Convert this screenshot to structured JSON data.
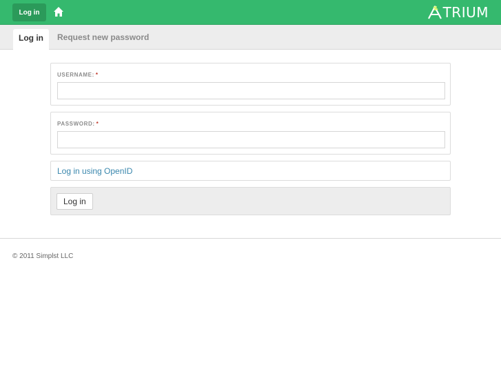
{
  "header": {
    "login_label": "Log in",
    "brand_text": "TRIUM",
    "accent_color": "#35b96e"
  },
  "tabs": [
    {
      "label": "Log in",
      "active": true
    },
    {
      "label": "Request new password",
      "active": false
    }
  ],
  "form": {
    "username": {
      "label": "USERNAME:",
      "required_marker": "*",
      "value": ""
    },
    "password": {
      "label": "PASSWORD:",
      "required_marker": "*",
      "value": ""
    },
    "openid_link": "Log in using OpenID",
    "submit_label": "Log in"
  },
  "footer": {
    "copyright": "© 2011 Simplst LLC"
  }
}
